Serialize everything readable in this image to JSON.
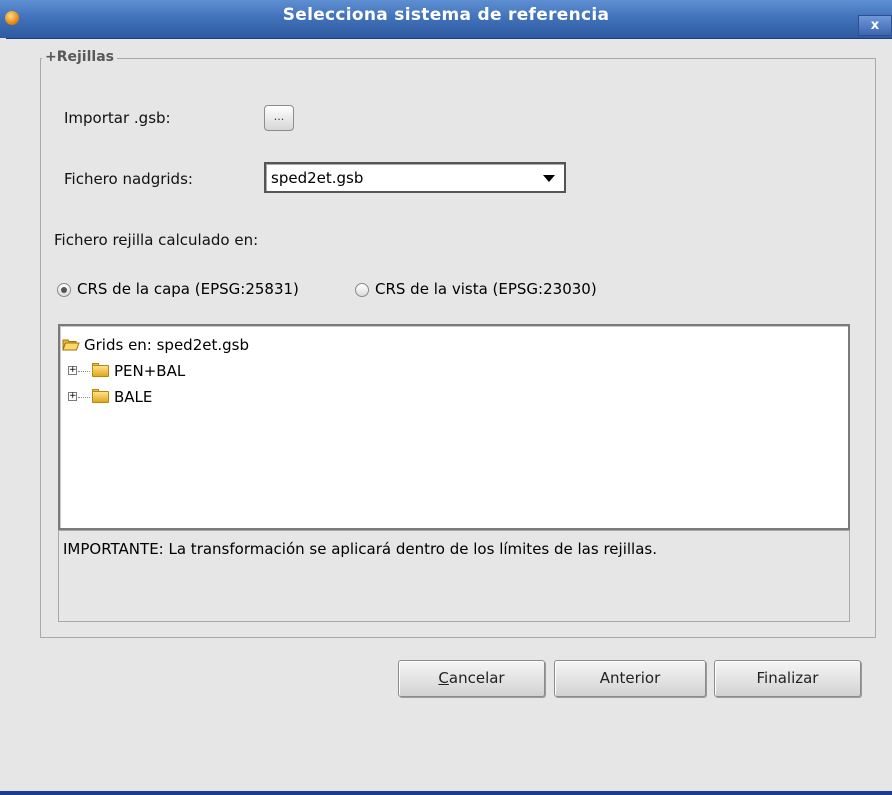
{
  "window": {
    "title": "Selecciona sistema de referencia",
    "close_label": "x"
  },
  "group": {
    "legend": "+Rejillas"
  },
  "import": {
    "label": "Importar .gsb:",
    "browse_label": "..."
  },
  "nadgrids": {
    "label": "Fichero nadgrids:",
    "selected": "sped2et.gsb"
  },
  "calc": {
    "label": "Fichero rejilla calculado en:",
    "options": [
      {
        "label": "CRS de la capa (EPSG:25831)",
        "selected": true
      },
      {
        "label": "CRS de la vista (EPSG:23030)",
        "selected": false
      }
    ]
  },
  "tree": {
    "root": "Grids en: sped2et.gsb",
    "nodes": [
      {
        "label": "PEN+BAL",
        "expander": "+"
      },
      {
        "label": "BALE",
        "expander": "+"
      }
    ]
  },
  "info": {
    "text": "IMPORTANTE: La transformación se aplicará dentro de los límites de las rejillas."
  },
  "buttons": {
    "cancel_mnemonic": "C",
    "cancel_rest": "ancelar",
    "previous": "Anterior",
    "finish": "Finalizar"
  }
}
